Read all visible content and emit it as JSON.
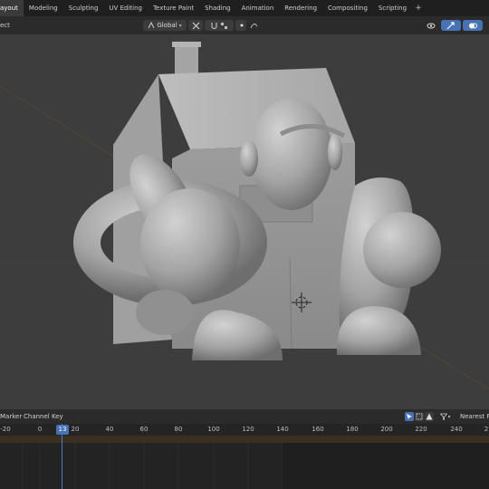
{
  "workspace_tabs": [
    {
      "label": "Layout",
      "shown": "ayout",
      "active": true
    },
    {
      "label": "Modeling",
      "shown": "Modeling",
      "active": false
    },
    {
      "label": "Sculpting",
      "shown": "Sculpting",
      "active": false
    },
    {
      "label": "UV Editing",
      "shown": "UV Editing",
      "active": false
    },
    {
      "label": "Texture Paint",
      "shown": "Texture Paint",
      "active": false
    },
    {
      "label": "Shading",
      "shown": "Shading",
      "active": false
    },
    {
      "label": "Animation",
      "shown": "Animation",
      "active": false
    },
    {
      "label": "Rendering",
      "shown": "Rendering",
      "active": false
    },
    {
      "label": "Compositing",
      "shown": "Compositing",
      "active": false
    },
    {
      "label": "Scripting",
      "shown": "Scripting",
      "active": false
    }
  ],
  "add_tab_label": "+",
  "viewport_header": {
    "menu_left": "ect",
    "orientation": "Global"
  },
  "timeline": {
    "menus": [
      "Marker",
      "Channel",
      "Key"
    ],
    "menus_shown": [
      "Marker",
      "Channel",
      "Key"
    ],
    "interpolation": "Nearest Fra",
    "current_frame": "13",
    "ruler_ticks": [
      "-20",
      "0",
      "20",
      "40",
      "60",
      "80",
      "100",
      "120",
      "140",
      "160",
      "180",
      "200",
      "220",
      "240",
      "2"
    ]
  },
  "colors": {
    "accent": "#4772b3",
    "viewport_bg": "#3d3d3d",
    "mesh": "#a8a8a8",
    "range_bar": "#3b2f22"
  }
}
